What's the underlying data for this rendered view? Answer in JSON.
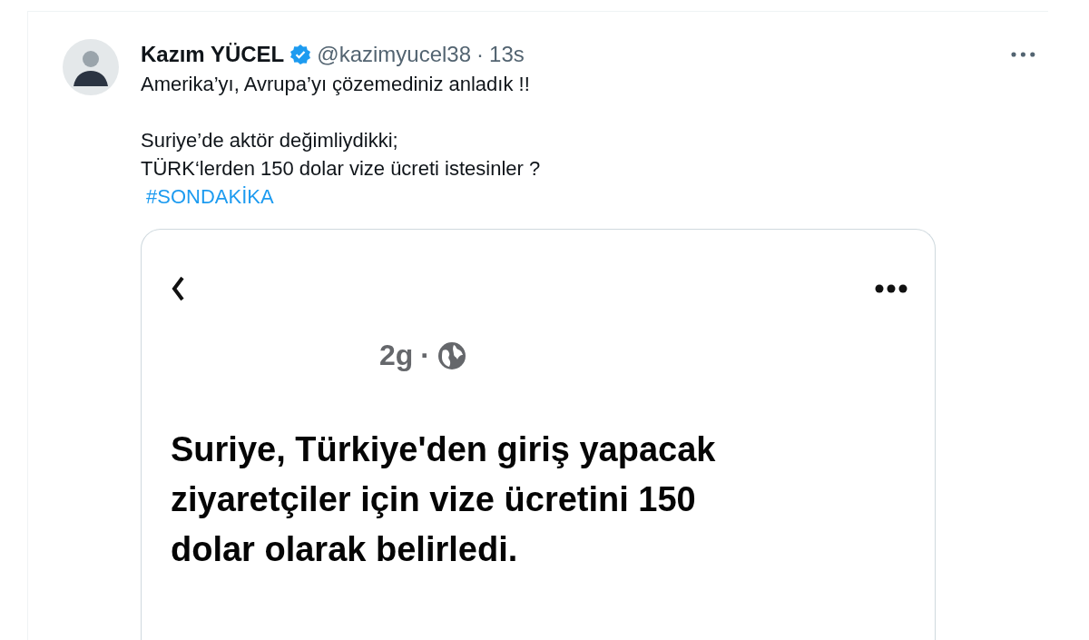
{
  "tweet": {
    "author": {
      "name": "Kazım YÜCEL",
      "verified": true,
      "handle": "@kazimyucel38",
      "separator": "·",
      "time": "13s"
    },
    "paragraphs": [
      [
        "Amerika’yı, Avrupa’yı çözemediniz anladık !!"
      ],
      [
        "Suriye’de aktör değimliydikki;",
        "TÜRK‘lerden 150 dolar vize ücreti istesinler ?"
      ]
    ],
    "hashtag": "#SONDAKİKA",
    "embedded_post": {
      "time": "2g",
      "separator": "·",
      "headline": [
        "Suriye, Türkiye'den giriş yapacak",
        "ziyaretçiler için vize ücretini 150",
        "dolar olarak belirledi."
      ]
    }
  }
}
